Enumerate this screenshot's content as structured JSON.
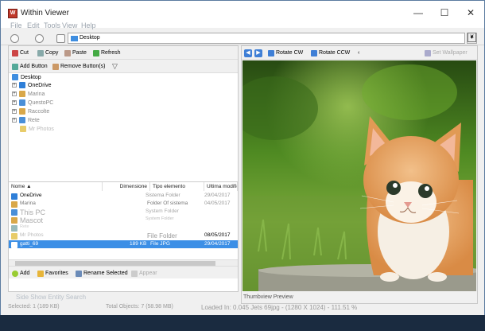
{
  "window": {
    "title": "Within Viewer",
    "app_icon_text": "W",
    "controls": {
      "minimize": "—",
      "maximize": "☐",
      "close": "✕"
    }
  },
  "menu": [
    "File",
    "Edit",
    "Tools",
    "View",
    "Help"
  ],
  "address": {
    "value": "Desktop",
    "dropdown": "▾",
    "close": "✕"
  },
  "toolbar": {
    "cut": "Cut",
    "copy": "Copy",
    "paste": "Paste",
    "refresh": "Refresh",
    "add_button": "Add Button",
    "remove_buttons": "Remove Button(s)"
  },
  "tree": {
    "root": "Desktop",
    "items": [
      {
        "label": "OneDrive",
        "color": "#2f7fd8"
      },
      {
        "label": "Marina",
        "color": "#d9a84a"
      },
      {
        "label": "QuestoPC",
        "color": "#4a8fd8"
      },
      {
        "label": "Raccolte",
        "color": "#d9a84a"
      },
      {
        "label": "Rete",
        "color": "#4a8fd8"
      },
      {
        "label": "Mr Photos",
        "color": "#e8cc6a"
      }
    ]
  },
  "list": {
    "headers": [
      "Nome",
      "Dimensione",
      "Tipo elemento",
      "Ultima modifica"
    ],
    "rows": [
      {
        "name": "OneDrive",
        "size": "",
        "type": "Sistema Folder",
        "date": "29/04/2017"
      },
      {
        "name": "Marina",
        "size": "",
        "type": "Folder Of sistema",
        "date": "04/05/2017"
      },
      {
        "name": "This PC",
        "size": "",
        "type": "System Folder",
        "date": ""
      },
      {
        "name": "Mascot",
        "size": "",
        "type": "System Folder",
        "date": ""
      },
      {
        "name": "Rete",
        "size": "",
        "type": "",
        "date": ""
      },
      {
        "name": "Mr Photos",
        "size": "",
        "type": "File Folder",
        "date": "08/05/2017"
      },
      {
        "name": "gatti_69",
        "size": "189 KB",
        "type": "File JPG",
        "date": "29/04/2017"
      }
    ],
    "selected_index": 6
  },
  "bottom_actions": {
    "add": "Add",
    "favorites": "Favorites",
    "rename": "Rename Selected",
    "appear": "Appear"
  },
  "slideshow_label": "Side Show Entity Search",
  "viewer_toolbar": {
    "rotate_cw": "Rotate CW",
    "rotate_ccw": "Rotate CCW",
    "set_wallpaper": "Set Wallpaper"
  },
  "preview_tab": "Thumbview Preview",
  "status": {
    "selected": "Selected: 1 (189 KB)",
    "total": "Total Objects: 7 (58.98 MB)",
    "loaded": "Loaded In: 0.045 Jets 69jpg - (1280 X 1024) - 111.51 %"
  },
  "colors": {
    "selection": "#3c8fe6",
    "accent": "#3f7fd6"
  }
}
